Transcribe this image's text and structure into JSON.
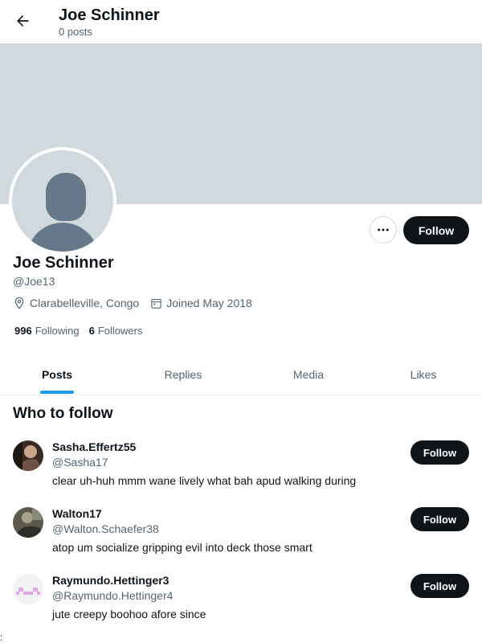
{
  "header": {
    "title": "Joe Schinner",
    "subtitle": "0 posts",
    "back_icon": "arrow-left-icon"
  },
  "profile": {
    "name": "Joe Schinner",
    "handle": "@Joe13",
    "location": "Clarabelleville, Congo",
    "joined": "Joined May 2018",
    "following_count": "996",
    "following_label": "Following",
    "followers_count": "6",
    "followers_label": "Followers",
    "follow_label": "Follow",
    "more_icon": "more-horizontal-icon",
    "location_icon": "location-pin-icon",
    "calendar_icon": "calendar-icon",
    "banner_color": "#cfd9de"
  },
  "tabs": [
    {
      "label": "Posts",
      "active": true
    },
    {
      "label": "Replies",
      "active": false
    },
    {
      "label": "Media",
      "active": false
    },
    {
      "label": "Likes",
      "active": false
    }
  ],
  "who_to_follow": {
    "title": "Who to follow",
    "users": [
      {
        "name": "Sasha.Effertz55",
        "handle": "@Sasha17",
        "bio": "clear uh-huh mmm wane lively what bah apud walking during",
        "follow_label": "Follow"
      },
      {
        "name": "Walton17",
        "handle": "@Walton.Schaefer38",
        "bio": "atop um socialize gripping evil into deck those smart",
        "follow_label": "Follow"
      },
      {
        "name": "Raymundo.Hettinger3",
        "handle": "@Raymundo.Hettinger4",
        "bio": "jute creepy boohoo afore since",
        "follow_label": "Follow"
      }
    ]
  },
  "edge_glyph": ":",
  "colors": {
    "accent": "#1d9bf0",
    "button_bg": "#0f1419",
    "secondary_text": "#536471"
  }
}
